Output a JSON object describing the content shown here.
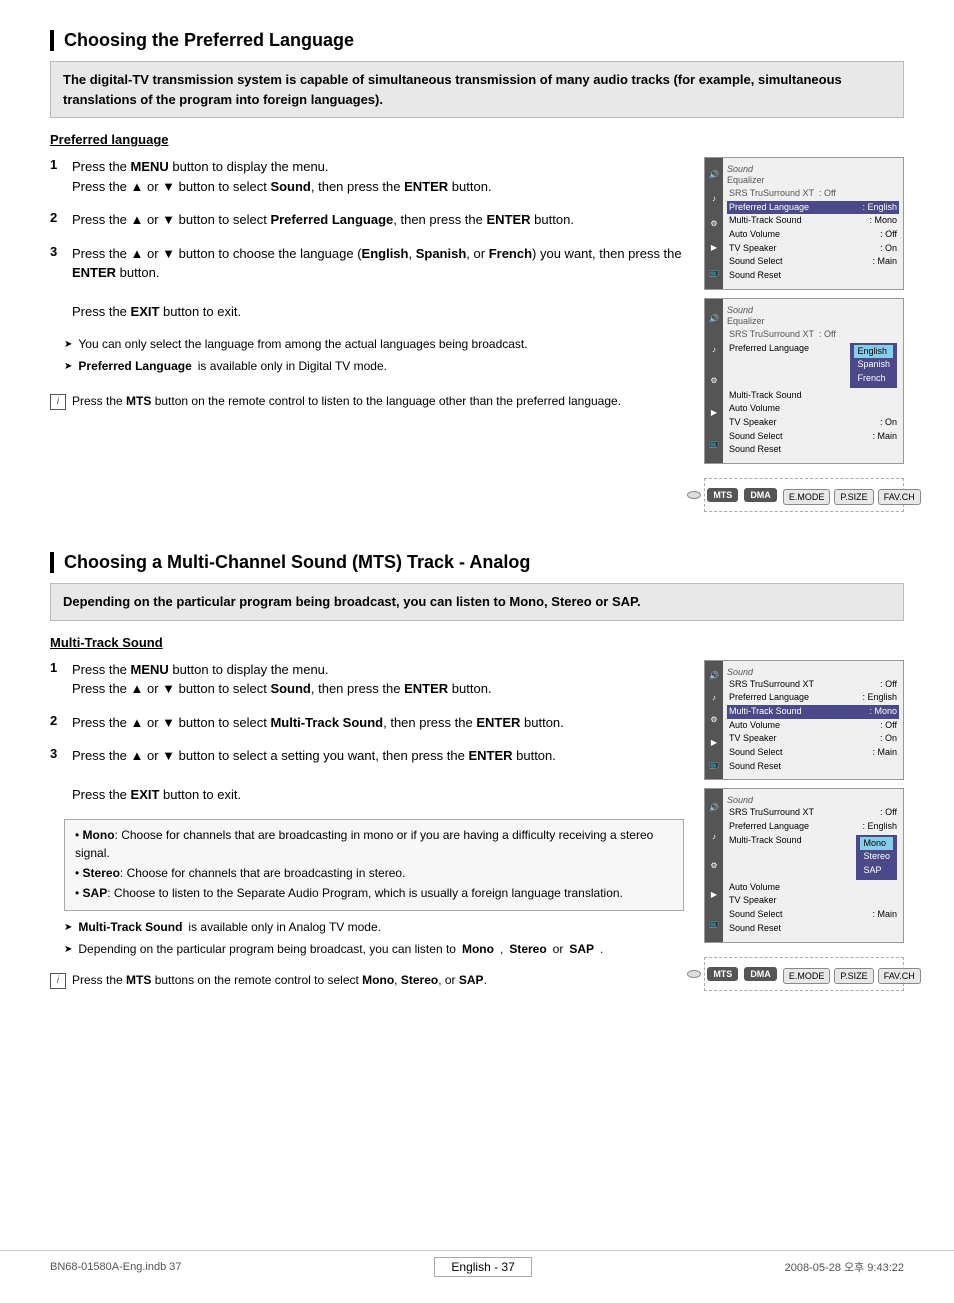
{
  "page": {
    "footer_left": "BN68-01580A-Eng.indb   37",
    "footer_right": "2008-05-28   오후  9:43:22",
    "page_number": "English - 37"
  },
  "section1": {
    "title": "Choosing the Preferred Language",
    "intro": "The digital-TV transmission system is capable of simultaneous transmission of many audio tracks (for example, simultaneous translations of the program into foreign languages).",
    "subsection": "Preferred language",
    "steps": [
      {
        "num": "1",
        "text1": "Press the ",
        "bold1": "MENU",
        "text2": " button to display the menu.",
        "text3": "Press the ▲ or ▼ button to select ",
        "bold2": "Sound",
        "text4": ", then press the ",
        "bold3": "ENTER",
        "text5": " button."
      },
      {
        "num": "2",
        "text1": "Press the ▲ or ▼ button to select ",
        "bold1": "Preferred Language",
        "text2": ", then press the ",
        "bold2": "ENTER",
        "text3": " button."
      },
      {
        "num": "3",
        "text1": "Press the ▲ or ▼ button to choose the language (",
        "bold1": "English",
        "text2": ", ",
        "bold2": "Spanish",
        "text3": ", or ",
        "bold3": "French",
        "text4": ") you want, then press the ",
        "bold4": "ENTER",
        "text5": " button."
      }
    ],
    "exit_note": "Press the EXIT button to exit.",
    "arrow_notes": [
      "You can only select the language from among the actual languages being broadcast.",
      "Preferred Language is available only in Digital TV mode."
    ],
    "mts_note": "Press the MTS button on the remote control to listen to the language other than the preferred language.",
    "screen1": {
      "title": "Equalizer",
      "subtitle": "SRS TruSurround XT   : Off",
      "rows": [
        {
          "label": "Preferred Language",
          "value": ": English",
          "highlighted": true
        },
        {
          "label": "Multi-Track Sound",
          "value": ": Mono",
          "highlighted": false
        },
        {
          "label": "Auto Volume",
          "value": ": Off",
          "highlighted": false
        },
        {
          "label": "TV Speaker",
          "value": ": On",
          "highlighted": false
        },
        {
          "label": "Sound Select",
          "value": ": Main",
          "highlighted": false
        },
        {
          "label": "Sound Reset",
          "value": "",
          "highlighted": false
        }
      ]
    },
    "screen2": {
      "title": "Equalizer",
      "subtitle": "SRS TruSurround XT   : Off",
      "rows": [
        {
          "label": "Preferred Language",
          "value": "",
          "highlighted": false
        },
        {
          "label": "Multi-Track Sound",
          "value": "",
          "highlighted": false
        },
        {
          "label": "Auto Volume",
          "value": "",
          "highlighted": false
        },
        {
          "label": "TV Speaker",
          "value": ": On",
          "highlighted": false
        },
        {
          "label": "Sound Select",
          "value": ": Main",
          "highlighted": false
        },
        {
          "label": "Sound Reset",
          "value": "",
          "highlighted": false
        }
      ],
      "dropdown": [
        "English",
        "Spanish",
        "French"
      ],
      "dropdown_selected": 0
    }
  },
  "section2": {
    "title": "Choosing a Multi-Channel Sound (MTS) Track - Analog",
    "intro": "Depending on the particular program being broadcast, you can listen to Mono, Stereo or SAP.",
    "subsection": "Multi-Track Sound",
    "steps": [
      {
        "num": "1",
        "text1": "Press the ",
        "bold1": "MENU",
        "text2": " button to display the menu.",
        "text3": "Press the ▲ or ▼ button to select ",
        "bold2": "Sound",
        "text4": ", then press the ",
        "bold3": "ENTER",
        "text5": " button."
      },
      {
        "num": "2",
        "text1": "Press the ▲ or ▼ button to select ",
        "bold1": "Multi-Track Sound",
        "text2": ", then press the ",
        "bold2": "ENTER",
        "text3": " button."
      },
      {
        "num": "3",
        "text1": "Press the ▲ or ▼ button to select a setting you want, then press the ",
        "bold1": "ENTER",
        "text2": " button."
      }
    ],
    "exit_note": "Press the EXIT button to exit.",
    "bullet_items": [
      {
        "bold": "Mono",
        "text": ": Choose for channels that are broadcasting in mono or if you are having a difficulty receiving a stereo signal."
      },
      {
        "bold": "Stereo",
        "text": ": Choose for channels that are broadcasting in stereo."
      },
      {
        "bold": "SAP",
        "text": ": Choose to listen to the Separate Audio Program, which is usually a foreign language translation."
      }
    ],
    "arrow_notes": [
      {
        "bold": "Multi-Track Sound",
        "text": " is available only in Analog TV mode."
      },
      {
        "text": "Depending on the particular program being broadcast, you can listen to "
      }
    ],
    "arrow_note2_bold_items": [
      "Mono",
      "Stereo",
      "SAP"
    ],
    "mts_note": "Press the MTS buttons on the remote control to select Mono, Stereo, or SAP.",
    "screen1": {
      "rows": [
        {
          "label": "SRS TruSurround XT",
          "value": ": Off",
          "highlighted": false
        },
        {
          "label": "Preferred Language",
          "value": ": English",
          "highlighted": false
        },
        {
          "label": "Multi-Track Sound",
          "value": ": Mono",
          "highlighted": true
        },
        {
          "label": "Auto Volume",
          "value": ": Off",
          "highlighted": false
        },
        {
          "label": "TV Speaker",
          "value": ": On",
          "highlighted": false
        },
        {
          "label": "Sound Select",
          "value": ": Main",
          "highlighted": false
        },
        {
          "label": "Sound Reset",
          "value": "",
          "highlighted": false
        }
      ]
    },
    "screen2": {
      "rows": [
        {
          "label": "SRS TruSurround XT",
          "value": ": Off",
          "highlighted": false
        },
        {
          "label": "Preferred Language",
          "value": ": English",
          "highlighted": false
        },
        {
          "label": "Multi-Track Sound",
          "value": "",
          "highlighted": false
        },
        {
          "label": "Auto Volume",
          "value": "",
          "highlighted": false
        },
        {
          "label": "TV Speaker",
          "value": "",
          "highlighted": false
        },
        {
          "label": "Sound Select",
          "value": ": Main",
          "highlighted": false
        },
        {
          "label": "Sound Reset",
          "value": "",
          "highlighted": false
        }
      ],
      "dropdown": [
        "Mono",
        "Stereo",
        "SAP"
      ],
      "dropdown_selected": 0
    }
  }
}
